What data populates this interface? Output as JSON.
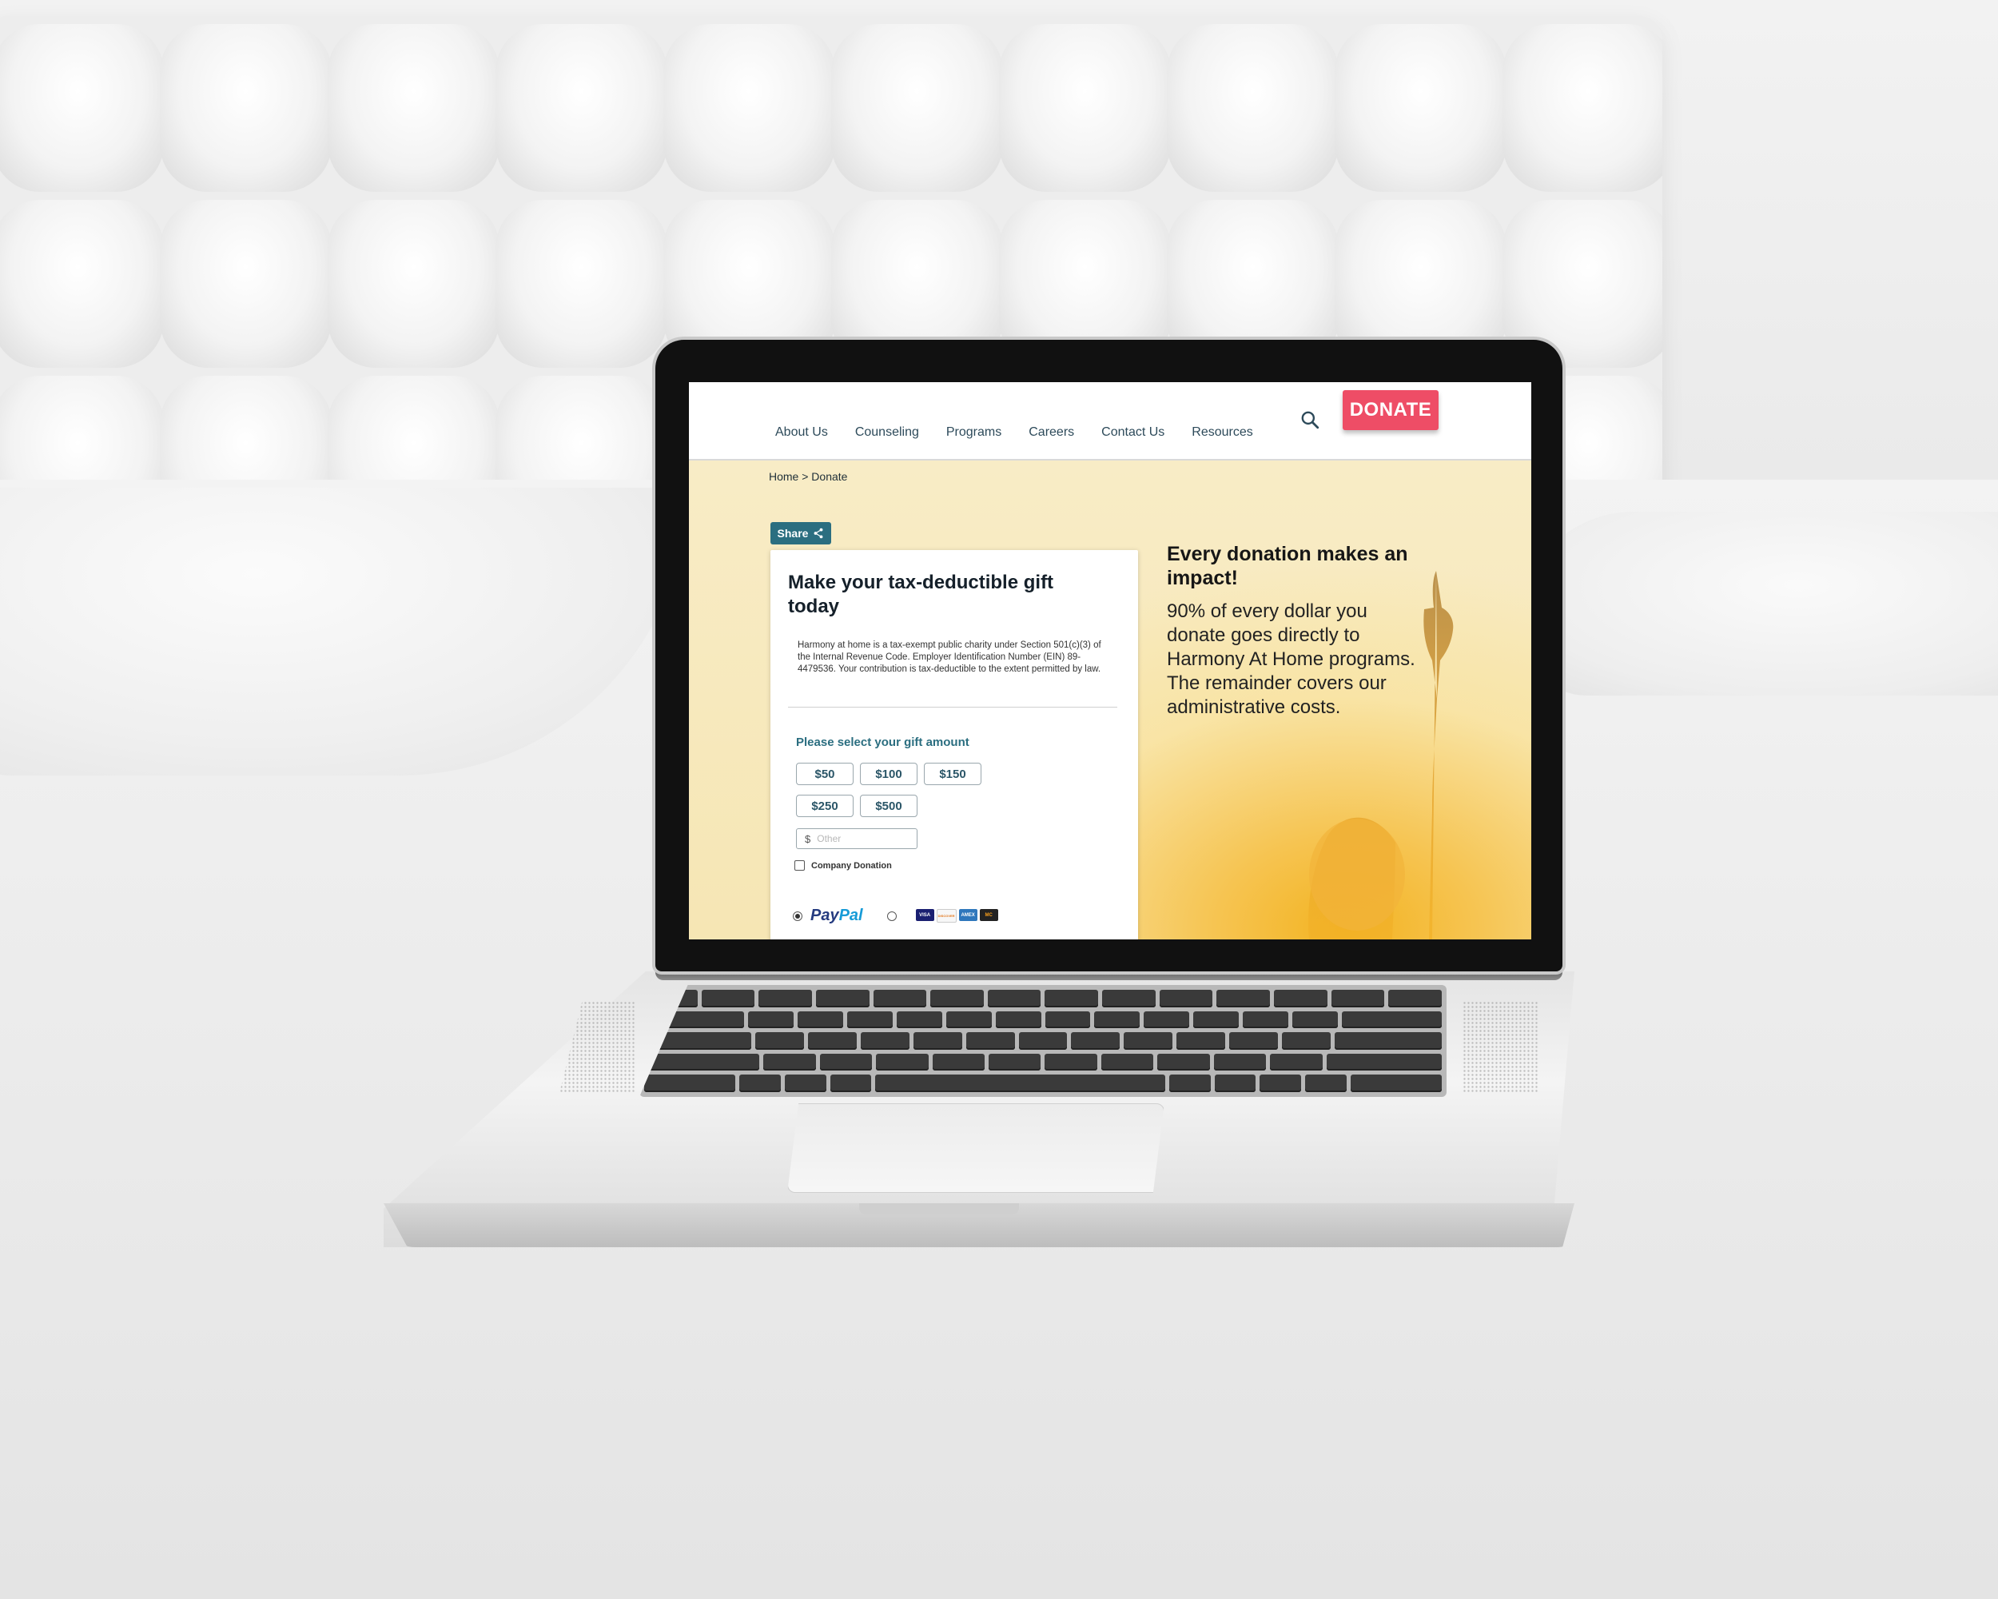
{
  "nav": {
    "links": [
      "About Us",
      "Counseling",
      "Programs",
      "Careers",
      "Contact Us",
      "Resources"
    ],
    "search_icon": "search-icon",
    "donate_label": "DONATE"
  },
  "breadcrumb": "Home > Donate",
  "share_label": "Share",
  "form": {
    "title": "Make your tax-deductible gift today",
    "legal": "Harmony at home is a tax-exempt public charity under Section 501(c)(3) of the Internal Revenue Code. Employer Identification Number (EIN) 89-4479536. Your contribution is tax-deductible to the extent permitted by law.",
    "gift_label": "Please select your gift amount",
    "amounts": [
      "$50",
      "$100",
      "$150",
      "$250",
      "$500"
    ],
    "other_prefix": "$",
    "other_placeholder": "Other",
    "company_label": "Company Donation",
    "paypal_part1": "Pay",
    "paypal_part2": "Pal",
    "card_logos": [
      "VISA",
      "DISCOVER",
      "AMEX",
      "MC"
    ]
  },
  "impact": {
    "title": "Every donation makes an impact!",
    "body": "90% of every dollar you donate goes directly to Harmony At Home programs. The remainder covers our administrative costs."
  },
  "colors": {
    "accent": "#2b6e80",
    "donate": "#ee4d66",
    "hero": "#f6e6b4"
  }
}
